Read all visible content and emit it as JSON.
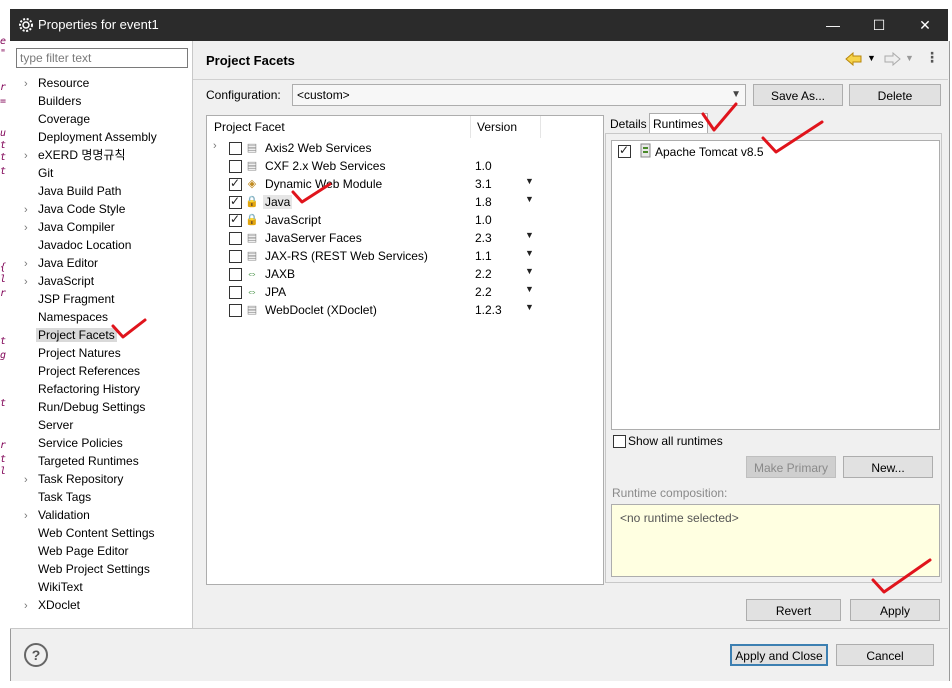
{
  "window": {
    "title": "Properties for event1",
    "minimize": "—",
    "maximize": "☐",
    "close": "✕"
  },
  "filter": {
    "placeholder": "type filter text",
    "value": ""
  },
  "nav": [
    {
      "label": "Resource",
      "expandable": true
    },
    {
      "label": "Builders",
      "expandable": false
    },
    {
      "label": "Coverage",
      "expandable": false
    },
    {
      "label": "Deployment Assembly",
      "expandable": false
    },
    {
      "label": "eXERD 명명규칙",
      "expandable": true
    },
    {
      "label": "Git",
      "expandable": false
    },
    {
      "label": "Java Build Path",
      "expandable": false
    },
    {
      "label": "Java Code Style",
      "expandable": true
    },
    {
      "label": "Java Compiler",
      "expandable": true
    },
    {
      "label": "Javadoc Location",
      "expandable": false
    },
    {
      "label": "Java Editor",
      "expandable": true
    },
    {
      "label": "JavaScript",
      "expandable": true
    },
    {
      "label": "JSP Fragment",
      "expandable": false
    },
    {
      "label": "Namespaces",
      "expandable": false
    },
    {
      "label": "Project Facets",
      "expandable": false,
      "selected": true
    },
    {
      "label": "Project Natures",
      "expandable": false
    },
    {
      "label": "Project References",
      "expandable": false
    },
    {
      "label": "Refactoring History",
      "expandable": false
    },
    {
      "label": "Run/Debug Settings",
      "expandable": false
    },
    {
      "label": "Server",
      "expandable": false
    },
    {
      "label": "Service Policies",
      "expandable": false
    },
    {
      "label": "Targeted Runtimes",
      "expandable": false
    },
    {
      "label": "Task Repository",
      "expandable": true
    },
    {
      "label": "Task Tags",
      "expandable": false
    },
    {
      "label": "Validation",
      "expandable": true
    },
    {
      "label": "Web Content Settings",
      "expandable": false
    },
    {
      "label": "Web Page Editor",
      "expandable": false
    },
    {
      "label": "Web Project Settings",
      "expandable": false
    },
    {
      "label": "WikiText",
      "expandable": false
    },
    {
      "label": "XDoclet",
      "expandable": true
    }
  ],
  "page": {
    "title": "Project Facets",
    "config_label": "Configuration:",
    "config_value": "<custom>",
    "save_as": "Save As...",
    "delete": "Delete"
  },
  "facets": {
    "col_facet": "Project Facet",
    "col_version": "Version",
    "rows": [
      {
        "name": "Axis2 Web Services",
        "version": "",
        "checked": false,
        "expandable": true,
        "icon": "page-icon",
        "dropdown": false
      },
      {
        "name": "CXF 2.x Web Services",
        "version": "1.0",
        "checked": false,
        "expandable": false,
        "icon": "page-icon",
        "dropdown": false
      },
      {
        "name": "Dynamic Web Module",
        "version": "3.1",
        "checked": true,
        "expandable": false,
        "icon": "web-module-icon",
        "dropdown": true
      },
      {
        "name": "Java",
        "version": "1.8",
        "checked": true,
        "expandable": false,
        "icon": "lock-icon",
        "dropdown": true,
        "selected": true
      },
      {
        "name": "JavaScript",
        "version": "1.0",
        "checked": true,
        "expandable": false,
        "icon": "lock-icon",
        "dropdown": false
      },
      {
        "name": "JavaServer Faces",
        "version": "2.3",
        "checked": false,
        "expandable": false,
        "icon": "page-icon",
        "dropdown": true
      },
      {
        "name": "JAX-RS (REST Web Services)",
        "version": "1.1",
        "checked": false,
        "expandable": false,
        "icon": "page-icon",
        "dropdown": true
      },
      {
        "name": "JAXB",
        "version": "2.2",
        "checked": false,
        "expandable": false,
        "icon": "arrows-icon",
        "dropdown": true
      },
      {
        "name": "JPA",
        "version": "2.2",
        "checked": false,
        "expandable": false,
        "icon": "arrows-icon",
        "dropdown": true
      },
      {
        "name": "WebDoclet (XDoclet)",
        "version": "1.2.3",
        "checked": false,
        "expandable": false,
        "icon": "page-icon",
        "dropdown": true
      }
    ]
  },
  "tabs": {
    "details": "Details",
    "runtimes": "Runtimes"
  },
  "runtimes": {
    "items": [
      {
        "name": "Apache Tomcat v8.5",
        "checked": true
      }
    ],
    "show_all": "Show all runtimes",
    "make_primary": "Make Primary",
    "new": "New...",
    "composition_label": "Runtime composition:",
    "composition_value": "<no runtime selected>"
  },
  "buttons": {
    "revert": "Revert",
    "apply": "Apply",
    "apply_close": "Apply and Close",
    "cancel": "Cancel"
  },
  "colors": {
    "annotation": "#e0141c",
    "accent": "#3c7fb1",
    "nav_selected": "#d9d9d9"
  }
}
